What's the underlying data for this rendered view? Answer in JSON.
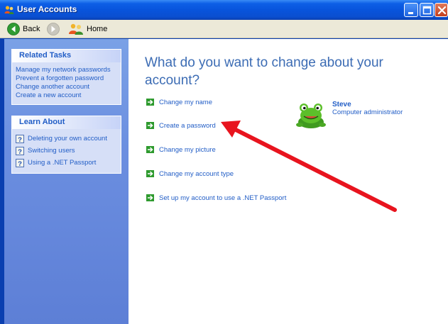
{
  "window": {
    "title": "User Accounts",
    "title_color": "#ffffff",
    "frame_color": "#0a3fb0"
  },
  "toolbar": {
    "back_label": "Back",
    "home_label": "Home"
  },
  "taskpane": {
    "related_tasks": {
      "title": "Related Tasks",
      "items": [
        "Manage my network passwords",
        "Prevent a forgotten password",
        "Change another account",
        "Create a new account"
      ]
    },
    "learn_about": {
      "title": "Learn About",
      "items": [
        "Deleting your own account",
        "Switching users",
        "Using a .NET Passport"
      ]
    }
  },
  "main": {
    "heading": "What do you want to change about your account?",
    "tasks": [
      "Change my name",
      "Create a password",
      "Change my picture",
      "Change my account type",
      "Set up my account to use a .NET Passport"
    ],
    "user": {
      "name": "Steve",
      "role": "Computer administrator"
    }
  },
  "colors": {
    "link": "#215dc6",
    "heading": "#3c6cb4",
    "annotation_arrow": "#e8141e",
    "task_arrow": "#2e9a2e"
  },
  "icons": {
    "title": "user-accounts-icon",
    "back": "back-arrow-icon",
    "forward": "forward-arrow-icon",
    "home": "home-users-icon",
    "help": "help-question-icon",
    "task": "green-arrow-icon",
    "avatar": "frog-avatar-icon"
  }
}
